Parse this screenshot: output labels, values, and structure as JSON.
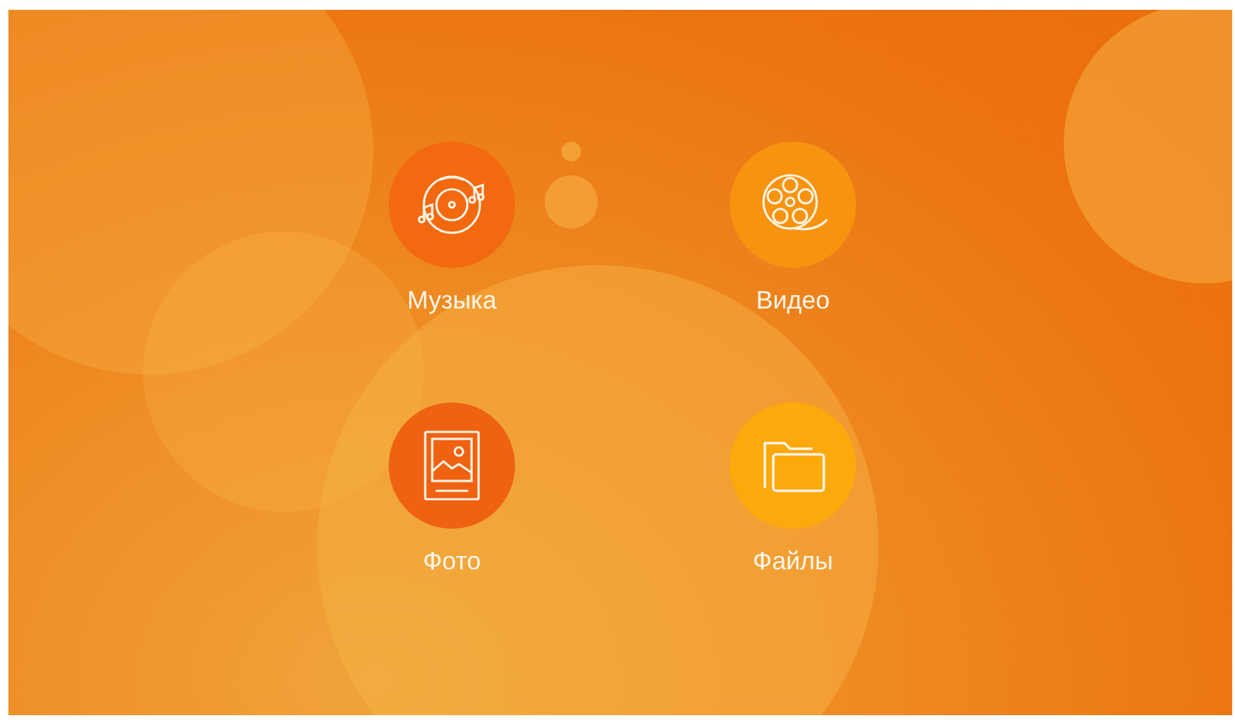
{
  "menu_items": [
    {
      "label": "Музыка",
      "kind": "music",
      "color": "#f2690f"
    },
    {
      "label": "Видео",
      "kind": "video",
      "color": "#f7930e"
    },
    {
      "label": "Фото",
      "kind": "photo",
      "color": "#ee6212"
    },
    {
      "label": "Файлы",
      "kind": "files",
      "color": "#fca90c"
    }
  ]
}
